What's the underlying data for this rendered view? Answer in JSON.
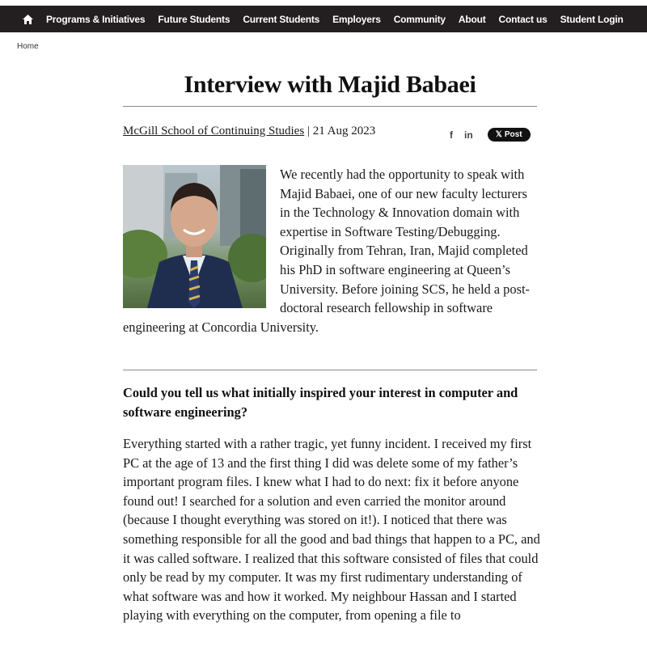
{
  "nav": {
    "home_icon": "home-icon",
    "items": [
      "Programs & Initiatives",
      "Future Students",
      "Current Students",
      "Employers",
      "Community",
      "About",
      "Contact us",
      "Student Login"
    ]
  },
  "breadcrumb": "Home",
  "article": {
    "title": "Interview with Majid Babaei",
    "author": "McGill School of Continuing Studies",
    "separator": "|",
    "date": "21 Aug 2023",
    "share": {
      "facebook": "f",
      "linkedin": "in",
      "x_post": "Post",
      "x_logo": "𝕏"
    },
    "intro": "We recently had the opportunity to speak with Majid Babaei, one of our new faculty lecturers in the Technology & Innovation domain with expertise in Software Testing/Debugging. Originally from Tehran, Iran, Majid completed his PhD in software engineering at Queen’s University. Before joining SCS, he held a post-doctoral research fellowship in software engineering at Concordia University.",
    "question": "Could you tell us what initially inspired your interest in computer and software engineering?",
    "answer": "Everything started with a rather tragic, yet funny incident. I received my first PC at the age of 13 and the first thing I did was delete some of my father’s important program files. I knew what I had to do next: fix it before anyone found out! I searched for a solution and even carried the monitor around (because I thought everything was stored on it!). I noticed that there was something responsible for all the good and bad things that happen to a PC, and it was called software. I realized that this software consisted of files that could only be read by my computer. It was my first rudimentary understanding of what software was and how it worked. My neighbour Hassan and I started playing with everything on the computer, from opening a file to"
  }
}
